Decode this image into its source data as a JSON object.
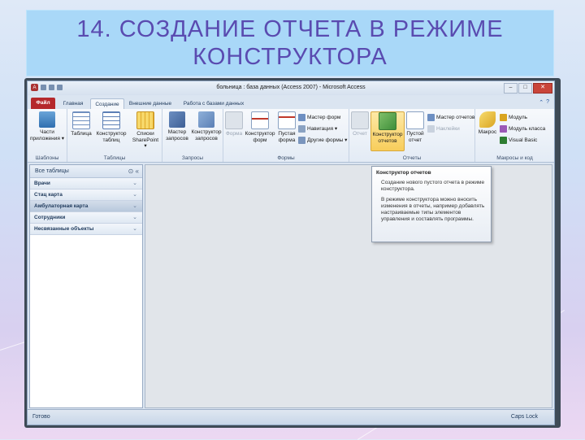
{
  "slide": {
    "title_line1": "14. СОЗДАНИЕ ОТЧЕТА В РЕЖИМЕ",
    "title_line2": "КОНСТРУКТОРА"
  },
  "window": {
    "title": "больница : база данных (Access 2007) - Microsoft Access",
    "minimize": "–",
    "maximize": "□",
    "close": "✕"
  },
  "tabs": {
    "file": "Файл",
    "home": "Главная",
    "create": "Создание",
    "external": "Внешние данные",
    "database": "Работа с базами данных"
  },
  "ribbon": {
    "templates": {
      "label": "Шаблоны",
      "parts": "Части приложения ▾"
    },
    "tables": {
      "label": "Таблицы",
      "table": "Таблица",
      "table_designer": "Конструктор таблиц",
      "sharepoint": "Списки SharePoint ▾"
    },
    "queries": {
      "label": "Запросы",
      "query_wizard": "Мастер запросов",
      "query_designer": "Конструктор запросов"
    },
    "forms": {
      "label": "Формы",
      "form": "Форма",
      "form_designer": "Конструктор форм",
      "blank_form": "Пустая форма",
      "form_wizard": "Мастер форм",
      "navigation": "Навигация ▾",
      "more_forms": "Другие формы ▾"
    },
    "reports": {
      "label": "Отчеты",
      "report": "Отчет",
      "report_designer": "Конструктор отчетов",
      "blank_report": "Пустой отчет",
      "report_wizard": "Мастер отчетов",
      "labels": "Наклейки"
    },
    "macros": {
      "label": "Макросы и код",
      "macro": "Макрос",
      "module": "Модуль",
      "class_module": "Модуль класса",
      "vb": "Visual Basic"
    }
  },
  "nav": {
    "header": "Все таблицы",
    "items": [
      {
        "label": "Врачи",
        "selected": false
      },
      {
        "label": "Стац карта",
        "selected": false
      },
      {
        "label": "Амбулаторная карта",
        "selected": true
      },
      {
        "label": "Сотрудники",
        "selected": false
      },
      {
        "label": "Несвязанные объекты",
        "selected": false
      }
    ]
  },
  "tooltip": {
    "title": "Конструктор отчетов",
    "p1": "Создание нового пустого отчета в режиме конструктора.",
    "p2": "В режиме конструктора можно вносить изменения в отчеты, например добавлять настраиваемые типы элементов управления и составлять программы."
  },
  "status": {
    "left": "Готово",
    "right": "Caps Lock"
  },
  "colors": {
    "accent": "#5a4bb0",
    "file_tab": "#b5282c",
    "title_band": "#a9d8f8"
  }
}
